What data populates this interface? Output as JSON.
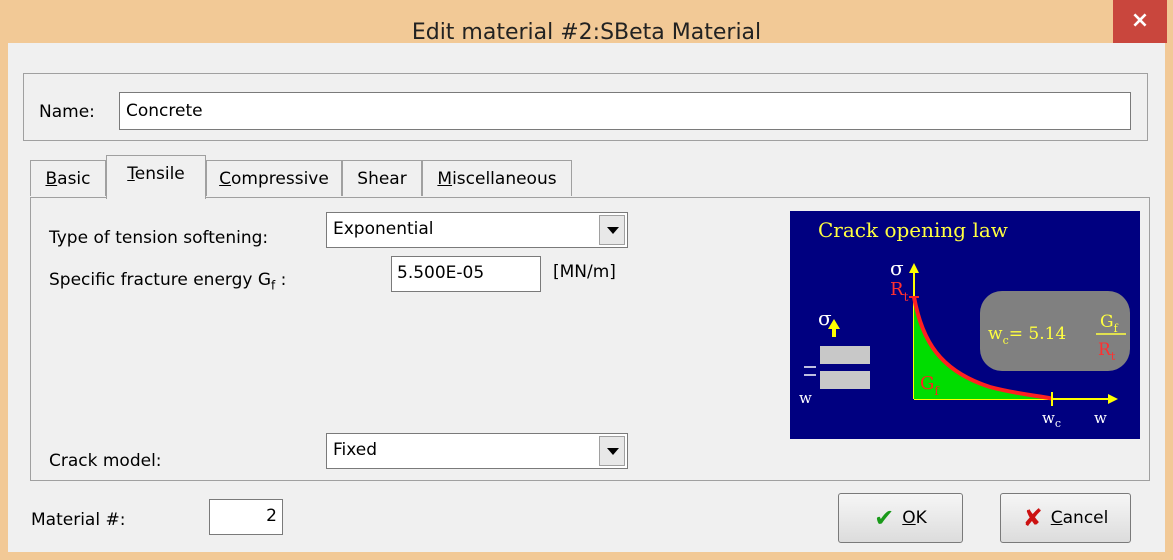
{
  "window": {
    "title": "Edit material #2:SBeta Material",
    "close_glyph": "×"
  },
  "name": {
    "label": "Name:",
    "value": "Concrete"
  },
  "tabs": [
    {
      "label": "Basic",
      "mnemonic": "B",
      "rest": "asic",
      "active": false
    },
    {
      "label": "Tensile",
      "mnemonic": "T",
      "rest": "ensile",
      "active": true
    },
    {
      "label": "Compressive",
      "mnemonic": "C",
      "rest": "ompressive",
      "active": false
    },
    {
      "label": "Shear",
      "mnemonic": "",
      "rest": "Shear",
      "active": false
    },
    {
      "label": "Miscellaneous",
      "mnemonic": "M",
      "rest": "iscellaneous",
      "active": false
    }
  ],
  "tensile": {
    "softening_label": "Type of tension softening:",
    "softening_value": "Exponential",
    "fracture_label_main": "Specific fracture energy G",
    "fracture_label_sub": "f",
    "fracture_label_colon": " :",
    "fracture_value": "5.500E-05",
    "fracture_unit": "[MN/m]",
    "crack_model_label": "Crack model:",
    "crack_model_value": "Fixed"
  },
  "diagram": {
    "title": "Crack opening law",
    "sigma": "σ",
    "Rt_main": "R",
    "Rt_sub": "t",
    "Gf_main": "G",
    "Gf_sub": "f",
    "wc_main": "w",
    "wc_sub": "c",
    "w": "w",
    "formula_lhs": "w",
    "formula_lhs_sub": "c",
    "formula_eq": "= 5.14",
    "colors": {
      "background": "#000080",
      "curve": "#ff2020",
      "fill": "#00dd00",
      "axis": "#ffff00",
      "text_yellow": "#ffff40",
      "text_red": "#ff3030",
      "bubble": "#808080"
    }
  },
  "bottom": {
    "material_label": "Material #:",
    "material_value": "2",
    "ok_label": "OK",
    "ok_mnemonic": "O",
    "ok_rest": "K",
    "cancel_label": "Cancel",
    "cancel_mnemonic": "C",
    "cancel_rest": "ancel",
    "ok_icon": "checkmark-icon",
    "cancel_icon": "cross-icon"
  }
}
